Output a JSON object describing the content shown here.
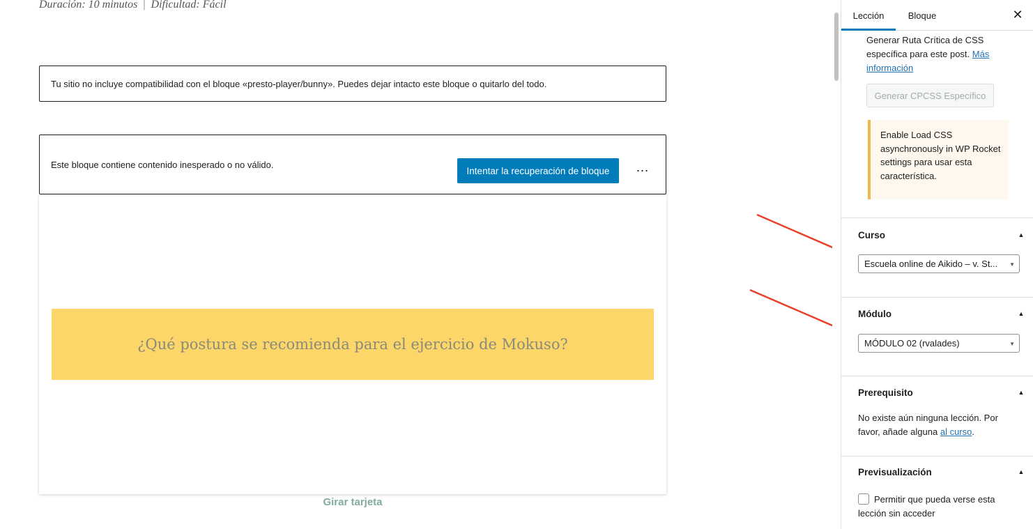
{
  "editor": {
    "duration": "Duración: 10 minutos",
    "separator": "|",
    "difficulty": "Dificultad: Fácil",
    "unsupported_notice": "Tu sitio no incluye compatibilidad con el bloque «presto-player/bunny». Puedes dejar intacto este bloque o quitarlo del todo.",
    "invalid_message": "Este bloque contiene contenido inesperado o no válido.",
    "recover_button": "Intentar la recuperación de bloque",
    "more_options": "⋯",
    "card_question": "¿Qué postura se recomienda para el ejercicio de Mokuso?",
    "flip_card": "Girar tarjeta"
  },
  "sidebar": {
    "tabs": [
      "Lección",
      "Bloque"
    ],
    "close_icon": "close-icon",
    "cpcss": {
      "text": "Generar Ruta Crítica de CSS específica para este post.",
      "link": "Más información",
      "button": "Generar CPCSS Específico"
    },
    "rocket_note": "Enable Load CSS asynchronously in WP Rocket settings para usar esta característica.",
    "curso": {
      "title": "Curso",
      "selected": "Escuela online de Aikido – v. St..."
    },
    "modulo": {
      "title": "Módulo",
      "selected": "MÓDULO 02 (rvalades)"
    },
    "prerequisito": {
      "title": "Prerequisito",
      "text": "No existe aún ninguna lección. Por favor, añade alguna",
      "link": "al curso",
      "suffix": "."
    },
    "preview": {
      "title": "Previsualización",
      "checkbox_label": "Permitir que pueda verse esta lección sin acceder"
    }
  },
  "colors": {
    "accent": "#007cba",
    "card_highlight": "#fcd668",
    "annotation_arrow": "#e8402a",
    "flip_link": "#82aaa2"
  }
}
